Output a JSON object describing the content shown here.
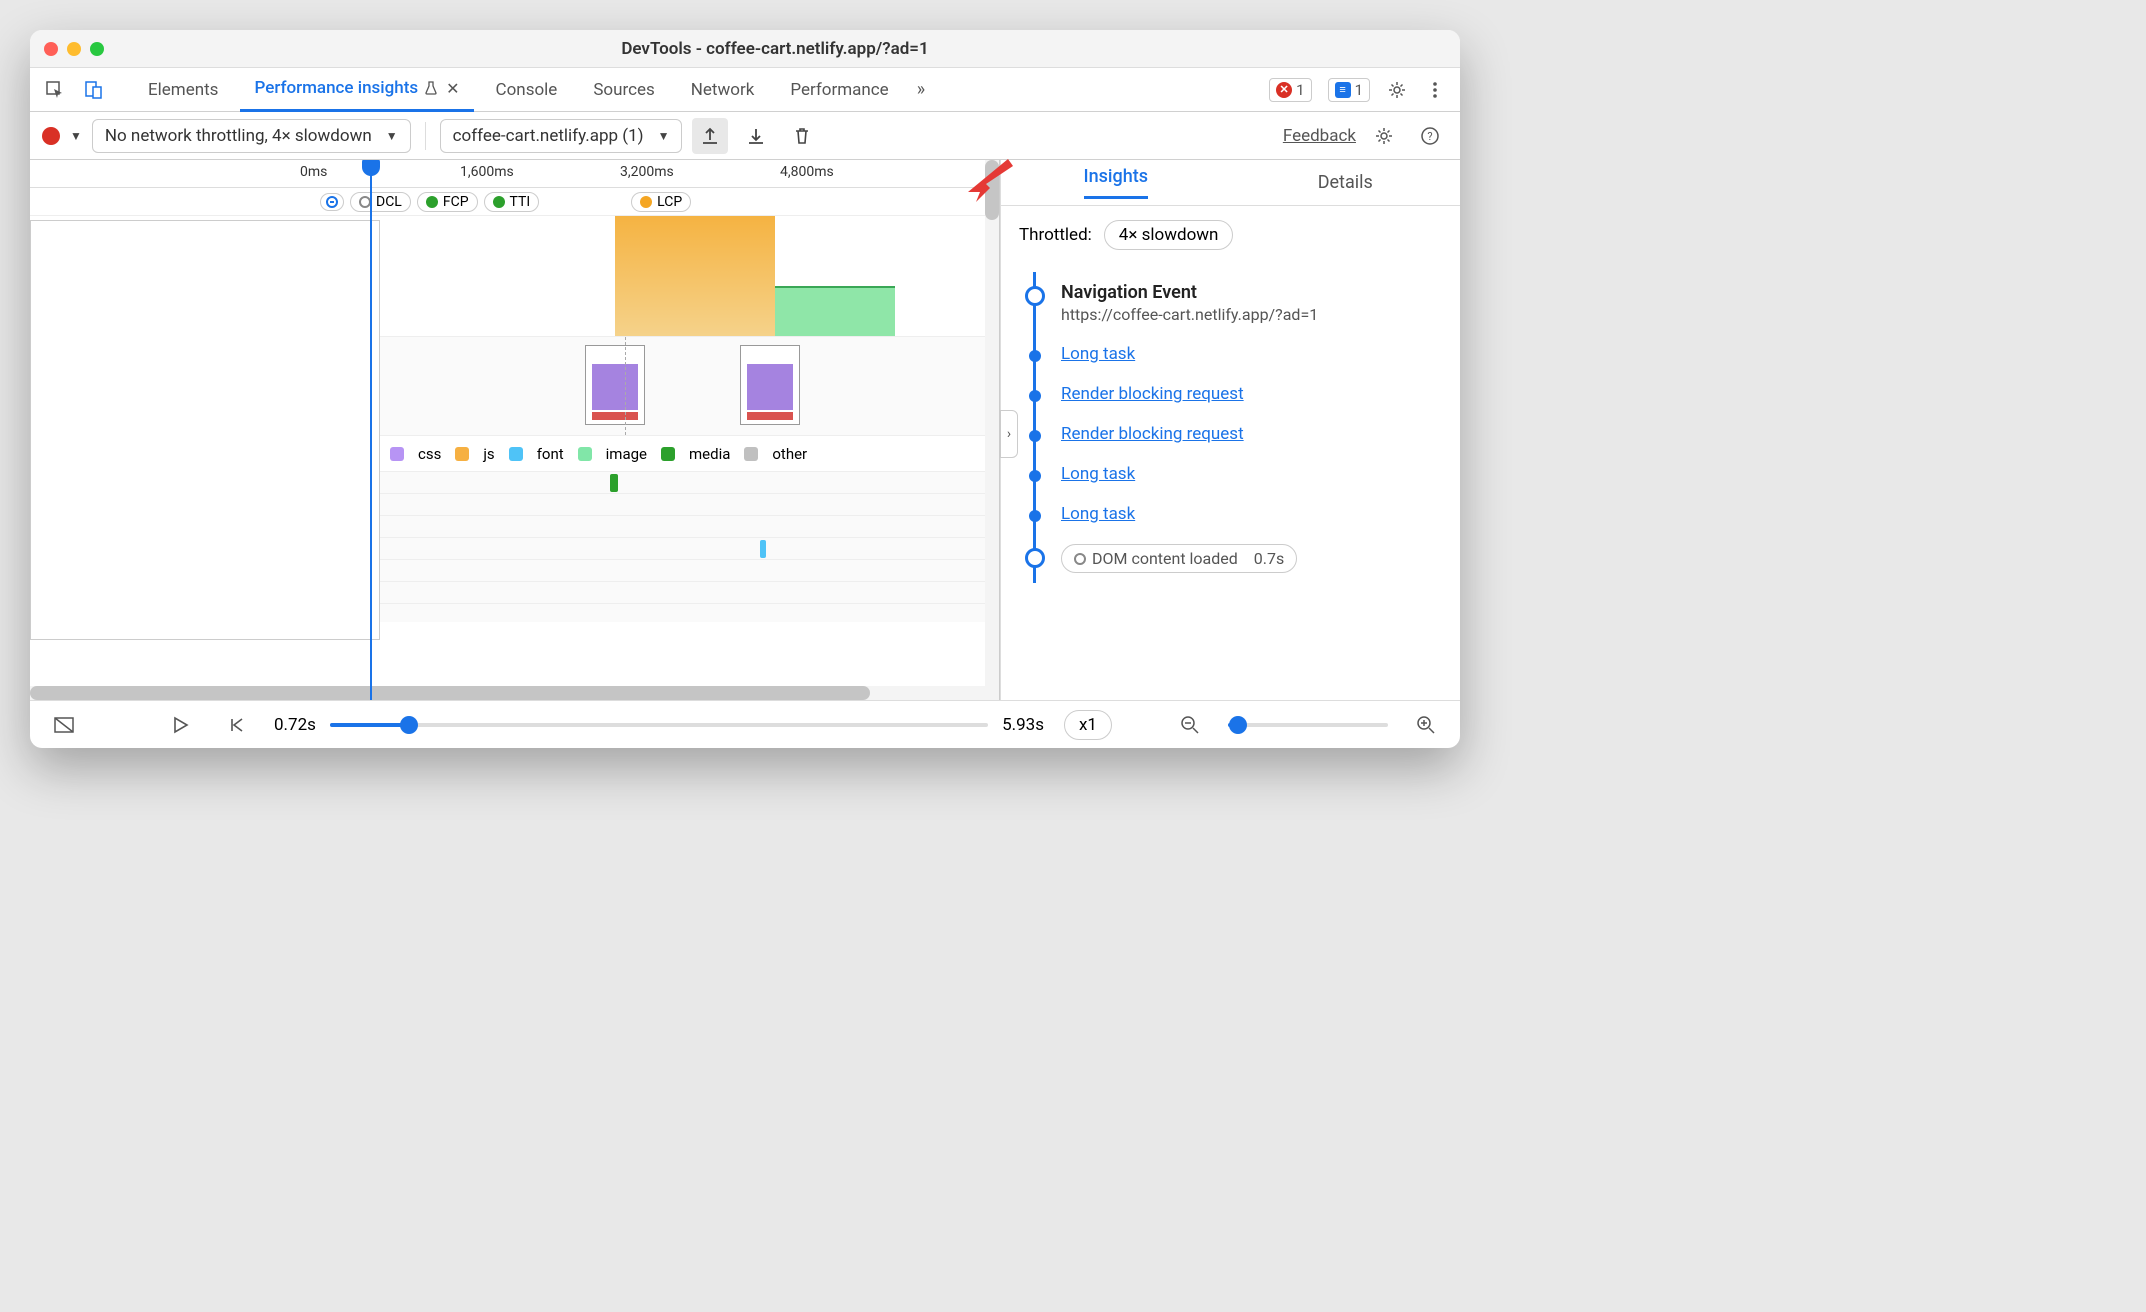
{
  "window": {
    "title": "DevTools - coffee-cart.netlify.app/?ad=1"
  },
  "tabs": {
    "elements": "Elements",
    "perf_insights": "Performance insights",
    "console": "Console",
    "sources": "Sources",
    "network": "Network",
    "performance": "Performance",
    "errors_count": "1",
    "messages_count": "1"
  },
  "toolbar": {
    "throttling_select": "No network throttling, 4× slowdown",
    "recording_select": "coffee-cart.netlify.app (1)",
    "feedback": "Feedback"
  },
  "ruler": {
    "t0": "0ms",
    "t1": "1,600ms",
    "t2": "3,200ms",
    "t3": "4,800ms"
  },
  "markers": {
    "dcl": "DCL",
    "fcp": "FCP",
    "tti": "TTI",
    "lcp": "LCP"
  },
  "legend": {
    "css": "css",
    "js": "js",
    "font": "font",
    "image": "image",
    "media": "media",
    "other": "other"
  },
  "colors": {
    "css": "#b794f4",
    "js": "#f6b042",
    "font": "#4fc3f7",
    "image": "#81e6a8",
    "media": "#2ca02c",
    "other": "#c0c0c0",
    "accent": "#1a73e8",
    "orange": "#f5a623",
    "green": "#2ca02c"
  },
  "sidebar": {
    "insights_tab": "Insights",
    "details_tab": "Details",
    "throttled_label": "Throttled:",
    "throttled_value": "4× slowdown",
    "nav_title": "Navigation Event",
    "nav_url": "https://coffee-cart.netlify.app/?ad=1",
    "items": [
      "Long task",
      "Render blocking request",
      "Render blocking request",
      "Long task",
      "Long task"
    ],
    "dcl_pill": "DOM content loaded",
    "dcl_time": "0.7s"
  },
  "footer": {
    "start_time": "0.72s",
    "end_time": "5.93s",
    "speed": "x1"
  }
}
